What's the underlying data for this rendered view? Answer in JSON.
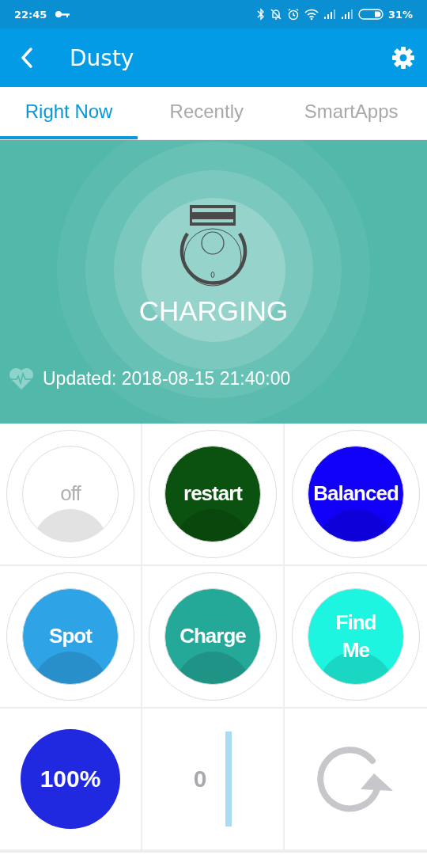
{
  "status_bar": {
    "time": "22:45",
    "battery": "31%"
  },
  "app_bar": {
    "title": "Dusty"
  },
  "tabs": [
    {
      "label": "Right Now",
      "selected": true
    },
    {
      "label": "Recently",
      "selected": false
    },
    {
      "label": "SmartApps",
      "selected": false
    }
  ],
  "status": {
    "state": "CHARGING",
    "updated": "Updated: 2018-08-15 21:40:00"
  },
  "buttons": [
    {
      "label": "off",
      "color": "#ffffff",
      "on": false
    },
    {
      "label": "restart",
      "color": "#0b510f",
      "on": true
    },
    {
      "label": "Balanced",
      "color": "#1100f8",
      "on": true
    },
    {
      "label": "Spot",
      "color": "#2ea3e6",
      "on": true
    },
    {
      "label": "Charge",
      "color": "#24a898",
      "on": true
    },
    {
      "label": "Find\nMe",
      "color": "#1ef5e0",
      "on": true
    }
  ],
  "battery": {
    "label": "100%"
  },
  "counter": {
    "value": "0"
  }
}
